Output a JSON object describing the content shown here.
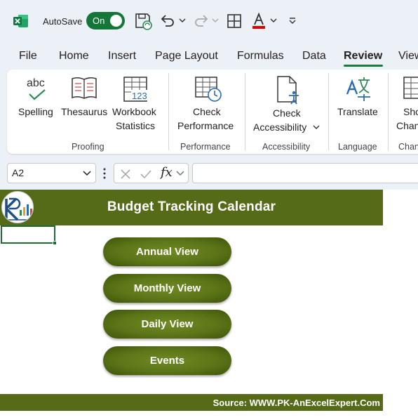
{
  "titlebar": {
    "autosave_label": "AutoSave",
    "autosave_state": "On"
  },
  "tabs": [
    {
      "label": "File"
    },
    {
      "label": "Home"
    },
    {
      "label": "Insert"
    },
    {
      "label": "Page Layout"
    },
    {
      "label": "Formulas"
    },
    {
      "label": "Data"
    },
    {
      "label": "Review",
      "active": true
    },
    {
      "label": "View"
    }
  ],
  "ribbon": {
    "spelling": {
      "line1": "Spelling"
    },
    "thesaurus": {
      "line1": "Thesaurus"
    },
    "workbook_statistics": {
      "line1": "Workbook",
      "line2": "Statistics"
    },
    "check_performance": {
      "line1": "Check",
      "line2": "Performance"
    },
    "check_accessibility": {
      "line1": "Check",
      "line2": "Accessibility"
    },
    "translate": {
      "line1": "Translate"
    },
    "show_changes": {
      "line1": "Sho",
      "line2": "Chan"
    },
    "groups": {
      "proofing": "Proofing",
      "performance": "Performance",
      "accessibility": "Accessibility",
      "language": "Language",
      "changes": "Chan"
    },
    "icon_text": {
      "abc": "abc",
      "num": "123"
    }
  },
  "formula_bar": {
    "name_box": "A2",
    "fx": "fx",
    "formula": ""
  },
  "sheet": {
    "title": "Budget Tracking Calendar",
    "nav_buttons": [
      {
        "label": "Annual View"
      },
      {
        "label": "Monthly View"
      },
      {
        "label": "Daily View"
      },
      {
        "label": "Events"
      }
    ],
    "source": "Source: WWW.PK-AnExcelExpert.Com"
  },
  "colors": {
    "excel_green": "#15763a",
    "band_olive": "#556b18",
    "accent_red": "#c00000"
  }
}
